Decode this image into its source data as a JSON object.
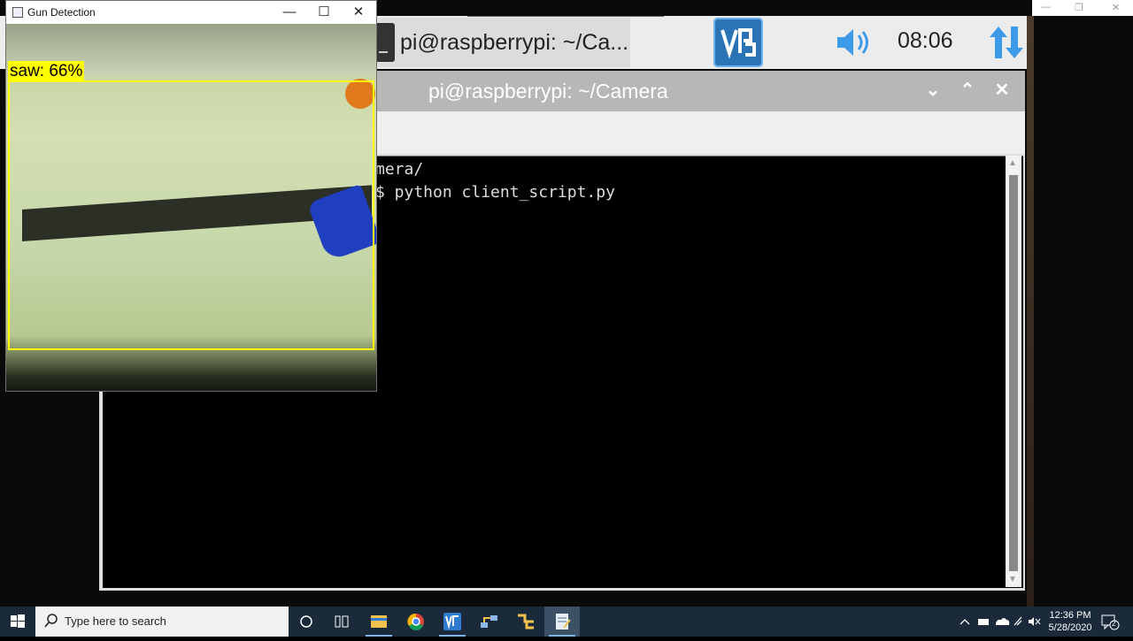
{
  "pi_taskbar": {
    "window_task": "pi@raspberrypi: ~/Ca...",
    "vnc_label": "V2",
    "clock": "08:06"
  },
  "terminal": {
    "title": "pi@raspberrypi: ~/Camera",
    "lines": [
      "mera/",
      "$ python client_script.py"
    ]
  },
  "gun_window": {
    "title": "Gun Detection",
    "detection_label": "saw: 66%",
    "box_color": "#ffff00"
  },
  "taskbar": {
    "search_placeholder": "Type here to search",
    "time": "12:36 PM",
    "date": "5/28/2020",
    "notification_count": "2"
  },
  "icons": [
    "windows-start-icon",
    "search-icon",
    "cortana-icon",
    "task-view-icon",
    "file-explorer-icon",
    "chrome-icon",
    "vnc-viewer-icon",
    "network-share-icon",
    "sftp-icon",
    "notepad-icon",
    "chevron-up-icon",
    "battery-icon",
    "cloud-icon",
    "wifi-icon",
    "mute-icon",
    "notification-icon"
  ]
}
